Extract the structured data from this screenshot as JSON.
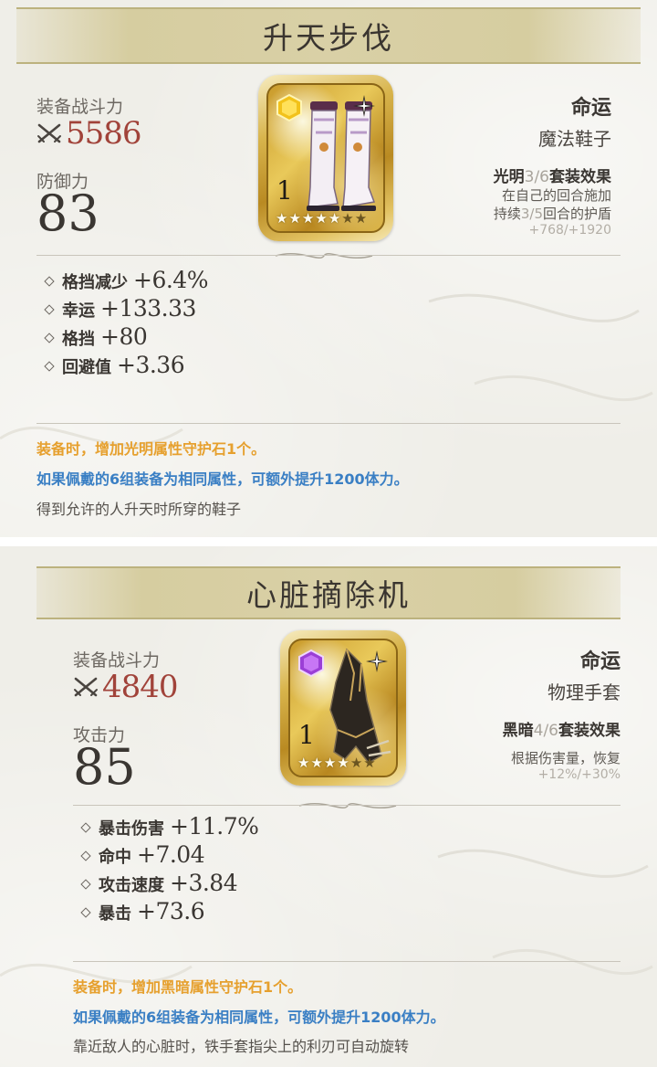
{
  "cards": [
    {
      "title": "升天步伐",
      "power_label": "装备战斗力",
      "power_value": "5586",
      "stat_label": "防御力",
      "stat_value": "83",
      "level": "1",
      "stars_on": 5,
      "stars_total": 7,
      "gem_color": "#f2c21a",
      "name": "命运",
      "type": "魔法鞋子",
      "set_element": "光明",
      "set_count": "3/6",
      "set_label": "套装效果",
      "desc_line1": "在自己的回合施加",
      "desc_line2_pre": "持续",
      "desc_line2_dim": "3/5",
      "desc_line2_post": "回合的护盾",
      "desc_values": "+768/+1920",
      "stats": [
        {
          "name": "格挡减少",
          "value": "+6.4%"
        },
        {
          "name": "幸运",
          "value": "+133.33"
        },
        {
          "name": "格挡",
          "value": "+80"
        },
        {
          "name": "回避值",
          "value": "+3.36"
        }
      ],
      "footer_orange": "装备时，增加光明属性守护石1个。",
      "footer_blue": "如果佩戴的6组装备为相同属性，可额外提升1200体力。",
      "footer_gray": "得到允许的人升天时所穿的鞋子"
    },
    {
      "title": "心脏摘除机",
      "power_label": "装备战斗力",
      "power_value": "4840",
      "stat_label": "攻击力",
      "stat_value": "85",
      "level": "1",
      "stars_on": 4,
      "stars_total": 6,
      "gem_color": "#9b3fd6",
      "name": "命运",
      "type": "物理手套",
      "set_element": "黑暗",
      "set_count": "4/6",
      "set_label": "套装效果",
      "desc_line1": "根据伤害量，恢复",
      "desc_values": "+12%/+30%",
      "stats": [
        {
          "name": "暴击伤害",
          "value": "+11.7%"
        },
        {
          "name": "命中",
          "value": "+7.04"
        },
        {
          "name": "攻击速度",
          "value": "+3.84"
        },
        {
          "name": "暴击",
          "value": "+73.6"
        }
      ],
      "footer_orange": "装备时，增加黑暗属性守护石1个。",
      "footer_blue": "如果佩戴的6组装备为相同属性，可额外提升1200体力。",
      "footer_gray": "靠近敌人的心脏时，铁手套指尖上的利刃可自动旋转"
    }
  ]
}
